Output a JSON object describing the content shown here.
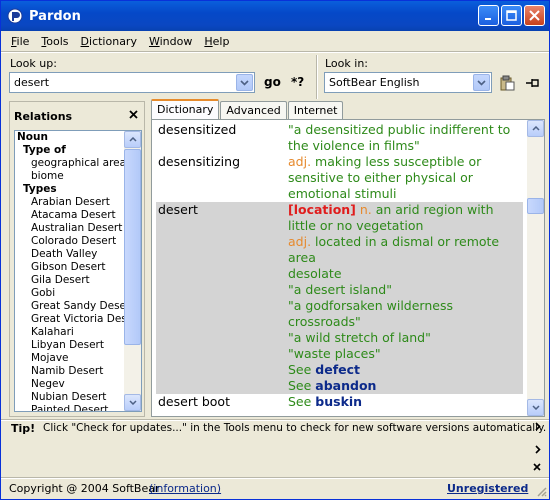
{
  "window": {
    "title": "Pardon"
  },
  "menu": [
    {
      "u": "F",
      "rest": "ile"
    },
    {
      "u": "T",
      "rest": "ools"
    },
    {
      "u": "D",
      "rest": "ictionary"
    },
    {
      "u": "W",
      "rest": "indow"
    },
    {
      "u": "H",
      "rest": "elp"
    }
  ],
  "lookup": {
    "label": "Look up:",
    "value": "desert",
    "go": "go",
    "wildcard": "*?"
  },
  "lookin": {
    "label": "Look in:",
    "value": "SoftBear English"
  },
  "relations": {
    "title": "Relations",
    "items": [
      {
        "text": "Noun",
        "level": 0,
        "bold": true
      },
      {
        "text": "Type of",
        "level": 1,
        "bold": true
      },
      {
        "text": "geographical area",
        "level": 2,
        "bold": false
      },
      {
        "text": "biome",
        "level": 2,
        "bold": false
      },
      {
        "text": "Types",
        "level": 1,
        "bold": true
      },
      {
        "text": "Arabian Desert",
        "level": 2,
        "bold": false
      },
      {
        "text": "Atacama Desert",
        "level": 2,
        "bold": false
      },
      {
        "text": "Australian Desert",
        "level": 2,
        "bold": false
      },
      {
        "text": "Colorado Desert",
        "level": 2,
        "bold": false
      },
      {
        "text": "Death Valley",
        "level": 2,
        "bold": false
      },
      {
        "text": "Gibson Desert",
        "level": 2,
        "bold": false
      },
      {
        "text": "Gila Desert",
        "level": 2,
        "bold": false
      },
      {
        "text": "Gobi",
        "level": 2,
        "bold": false
      },
      {
        "text": "Great Sandy Desert",
        "level": 2,
        "bold": false
      },
      {
        "text": "Great Victoria Desert",
        "level": 2,
        "bold": false
      },
      {
        "text": "Kalahari",
        "level": 2,
        "bold": false
      },
      {
        "text": "Libyan Desert",
        "level": 2,
        "bold": false
      },
      {
        "text": "Mojave",
        "level": 2,
        "bold": false
      },
      {
        "text": "Namib Desert",
        "level": 2,
        "bold": false
      },
      {
        "text": "Negev",
        "level": 2,
        "bold": false
      },
      {
        "text": "Nubian Desert",
        "level": 2,
        "bold": false
      },
      {
        "text": "Painted Desert",
        "level": 2,
        "bold": false
      }
    ]
  },
  "tabs": [
    "Dictionary",
    "Advanced",
    "Internet"
  ],
  "entries": [
    {
      "word": "desensitized",
      "selected": false,
      "lines": [
        [
          {
            "t": "\"a desensitized public indifferent to",
            "c": "green"
          }
        ],
        [
          {
            "t": "the violence in films\"",
            "c": "green"
          }
        ]
      ]
    },
    {
      "word": "desensitizing",
      "selected": false,
      "lines": [
        [
          {
            "t": "adj.",
            "c": "orange"
          },
          {
            "t": " making less susceptible or",
            "c": "green"
          }
        ],
        [
          {
            "t": "sensitive to either physical or",
            "c": "green"
          }
        ],
        [
          {
            "t": "emotional stimuli",
            "c": "green"
          }
        ]
      ]
    },
    {
      "word": "desert",
      "selected": true,
      "lines": [
        [
          {
            "t": "[location]",
            "c": "red"
          },
          {
            "t": " n.",
            "c": "orange"
          },
          {
            "t": " an arid region with",
            "c": "green"
          }
        ],
        [
          {
            "t": "little or no vegetation",
            "c": "green"
          }
        ],
        [
          {
            "t": "adj.",
            "c": "orange"
          },
          {
            "t": " located in a dismal or remote",
            "c": "green"
          }
        ],
        [
          {
            "t": "area",
            "c": "green"
          }
        ],
        [
          {
            "t": "desolate",
            "c": "green"
          }
        ],
        [
          {
            "t": "\"a desert island\"",
            "c": "green"
          }
        ],
        [
          {
            "t": "\"a godforsaken wilderness",
            "c": "green"
          }
        ],
        [
          {
            "t": "crossroads\"",
            "c": "green"
          }
        ],
        [
          {
            "t": "\"a wild stretch of land\"",
            "c": "green"
          }
        ],
        [
          {
            "t": "\"waste places\"",
            "c": "green"
          }
        ],
        [
          {
            "t": "See ",
            "c": "green"
          },
          {
            "t": "defect",
            "c": "navy"
          }
        ],
        [
          {
            "t": "See ",
            "c": "green"
          },
          {
            "t": "abandon",
            "c": "navy"
          }
        ]
      ]
    },
    {
      "word": "desert boot",
      "selected": false,
      "lines": [
        [
          {
            "t": "See ",
            "c": "green"
          },
          {
            "t": "buskin",
            "c": "navy"
          }
        ]
      ]
    }
  ],
  "tip": {
    "label": "Tip!",
    "text": "Click \"Check for updates...\" in the Tools menu to check for new software versions automatically."
  },
  "status": {
    "copyright": "Copyright @ 2004 SoftBear",
    "info": "(information)",
    "unregistered": "Unregistered"
  },
  "colors": {
    "title_bar": "#0548c8",
    "definition": "#2e8a1a",
    "part_of_speech": "#e68a2e",
    "category": "#e01c1c",
    "link": "#0c2a8a",
    "selection": "#d4d4d4"
  }
}
